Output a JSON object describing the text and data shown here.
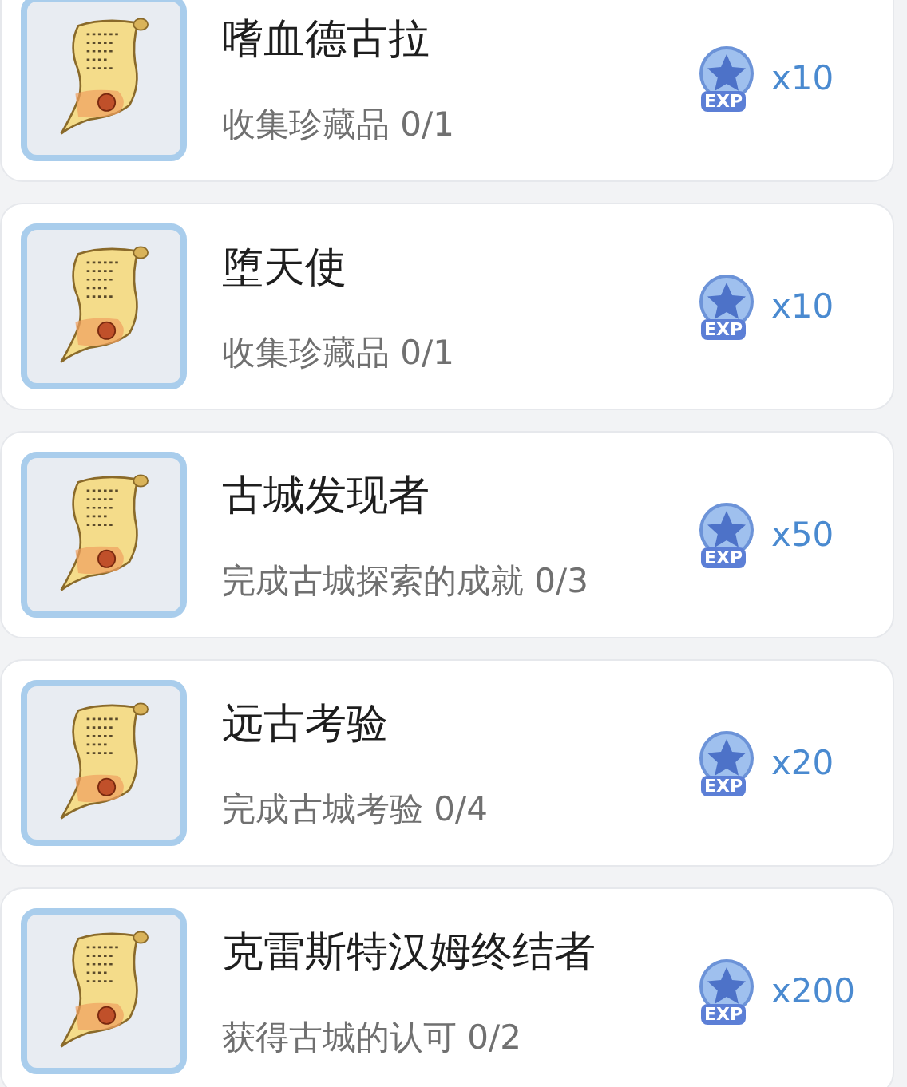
{
  "achievements": [
    {
      "title": "嗜血德古拉",
      "description": "收集珍藏品 0/1",
      "reward_badge": "EXP",
      "reward": "x10"
    },
    {
      "title": "堕天使",
      "description": "收集珍藏品 0/1",
      "reward_badge": "EXP",
      "reward": "x10"
    },
    {
      "title": "古城发现者",
      "description": "完成古城探索的成就 0/3",
      "reward_badge": "EXP",
      "reward": "x50"
    },
    {
      "title": "远古考验",
      "description": "完成古城考验 0/4",
      "reward_badge": "EXP",
      "reward": "x20"
    },
    {
      "title": "克雷斯特汉姆终结者",
      "description": "获得古城的认可 0/2",
      "reward_badge": "EXP",
      "reward": "x200"
    }
  ]
}
